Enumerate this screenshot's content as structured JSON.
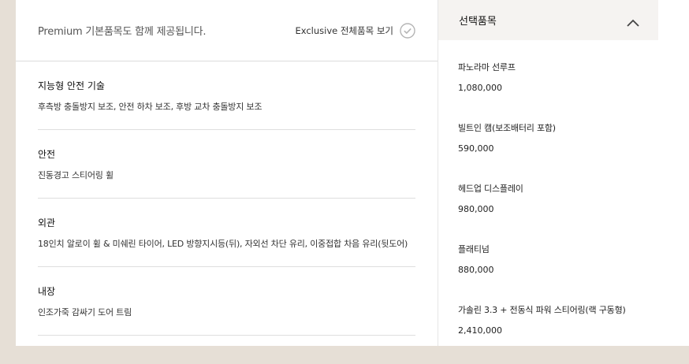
{
  "left": {
    "header_title": "Premium 기본품목도 함께 제공됩니다.",
    "view_all_label": "Exclusive 전체품목 보기",
    "groups": [
      {
        "title": "지능형 안전 기술",
        "desc": "후측방 충돌방지 보조, 안전 하차 보조, 후방 교차 충돌방지 보조"
      },
      {
        "title": "안전",
        "desc": "진동경고 스티어링 휠"
      },
      {
        "title": "외관",
        "desc": "18인치 알로이 휠 & 미쉐린 타이어, LED 방향지시등(뒤), 자외선 차단 유리, 이중접합 차음 유리(뒷도어)"
      },
      {
        "title": "내장",
        "desc": "인조가죽 감싸기 도어 트림"
      }
    ]
  },
  "right": {
    "header_title": "선택품목",
    "items": [
      {
        "name": "파노라마 선루프",
        "price": "1,080,000"
      },
      {
        "name": "빌트인 캠(보조배터리 포함)",
        "price": "590,000"
      },
      {
        "name": "헤드업 디스플레이",
        "price": "980,000"
      },
      {
        "name": "플래티넘",
        "price": "880,000"
      },
      {
        "name": "가솔린 3.3 + 전동식 파워 스티어링(랙 구동형)",
        "price": "2,410,000"
      }
    ]
  },
  "icons": {
    "view_all": "check-circle-icon",
    "collapse": "chevron-up-icon"
  }
}
